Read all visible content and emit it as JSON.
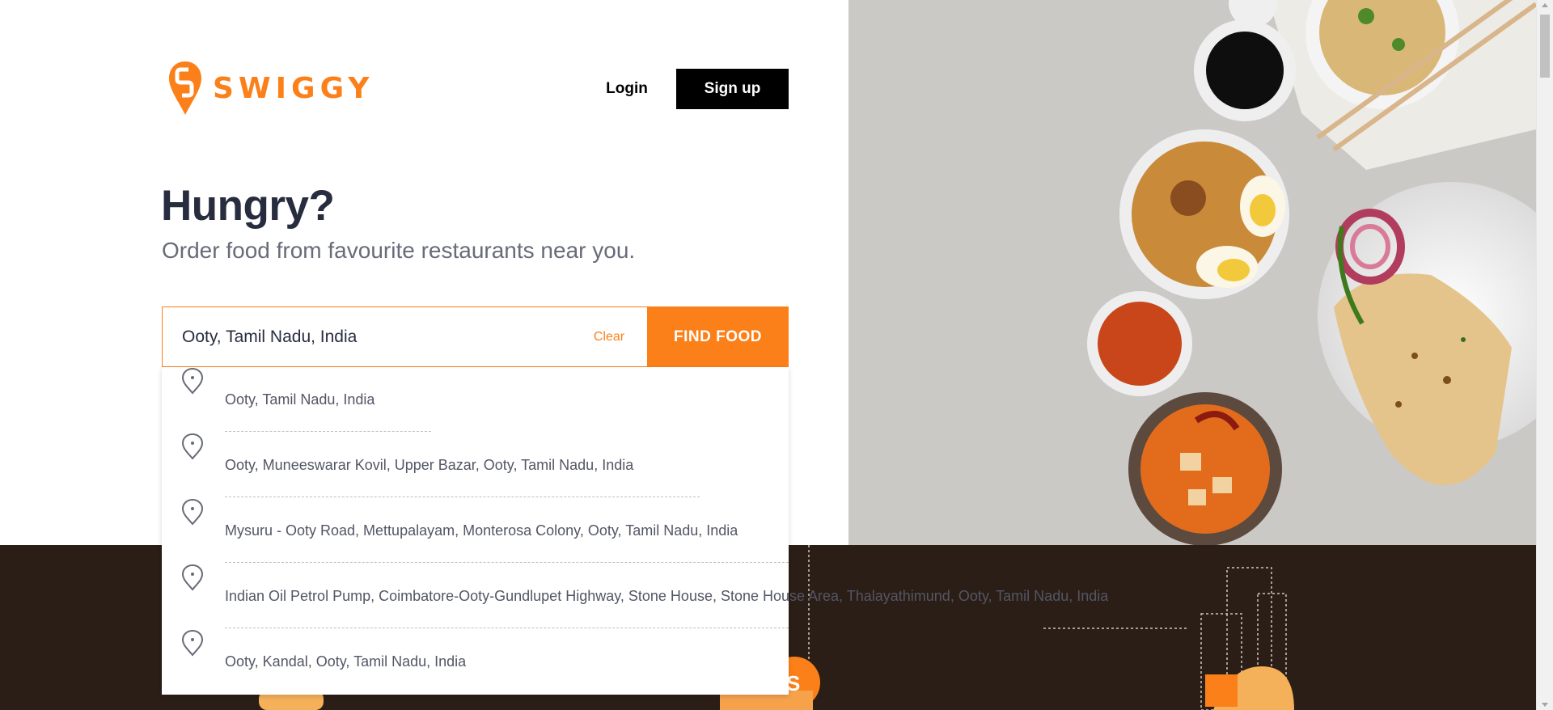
{
  "brand": {
    "name": "SWIGGY",
    "color": "#fc8019"
  },
  "header": {
    "login_label": "Login",
    "signup_label": "Sign up"
  },
  "hero": {
    "title": "Hungry?",
    "subtitle": "Order food from favourite restaurants near you."
  },
  "search": {
    "value": "Ooty, Tamil Nadu, India",
    "clear_label": "Clear",
    "find_label": "FIND FOOD"
  },
  "suggestions": [
    {
      "text": "Ooty, Tamil Nadu, India"
    },
    {
      "text": "Ooty, Muneeswarar Kovil, Upper Bazar, Ooty, Tamil Nadu, India"
    },
    {
      "text": "Mysuru - Ooty Road, Mettupalayam, Monterosa Colony, Ooty, Tamil Nadu, India"
    },
    {
      "text": "Indian Oil Petrol Pump, Coimbatore-Ooty-Gundlupet Highway, Stone House, Stone House Area, Thalayathimund, Ooty, Tamil Nadu, India"
    },
    {
      "text": "Ooty, Kandal, Ooty, Tamil Nadu, India"
    }
  ],
  "icons": {
    "logo": "swiggy-logo-icon",
    "pin": "location-pin-icon"
  },
  "colors": {
    "accent": "#fc8019",
    "dark_band": "#2b1e16",
    "text_primary": "#282c3f",
    "text_secondary": "#686b78"
  }
}
